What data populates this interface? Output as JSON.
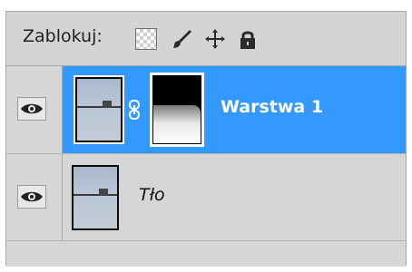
{
  "lock_bar": {
    "label": "Zablokuj:",
    "icons": [
      "lock-transparent-pixels-icon",
      "lock-image-pixels-brush-icon",
      "lock-position-move-icon",
      "lock-all-padlock-icon"
    ]
  },
  "layers": [
    {
      "name": "Warstwa 1",
      "selected": true,
      "visible": true,
      "has_mask": true,
      "linked": true
    },
    {
      "name": "Tło",
      "selected": false,
      "visible": true,
      "has_mask": false,
      "linked": false
    }
  ],
  "colors": {
    "selected_row": "#3399ff",
    "panel_bg": "#d6d6d6",
    "selected_text": "#ffffff"
  }
}
